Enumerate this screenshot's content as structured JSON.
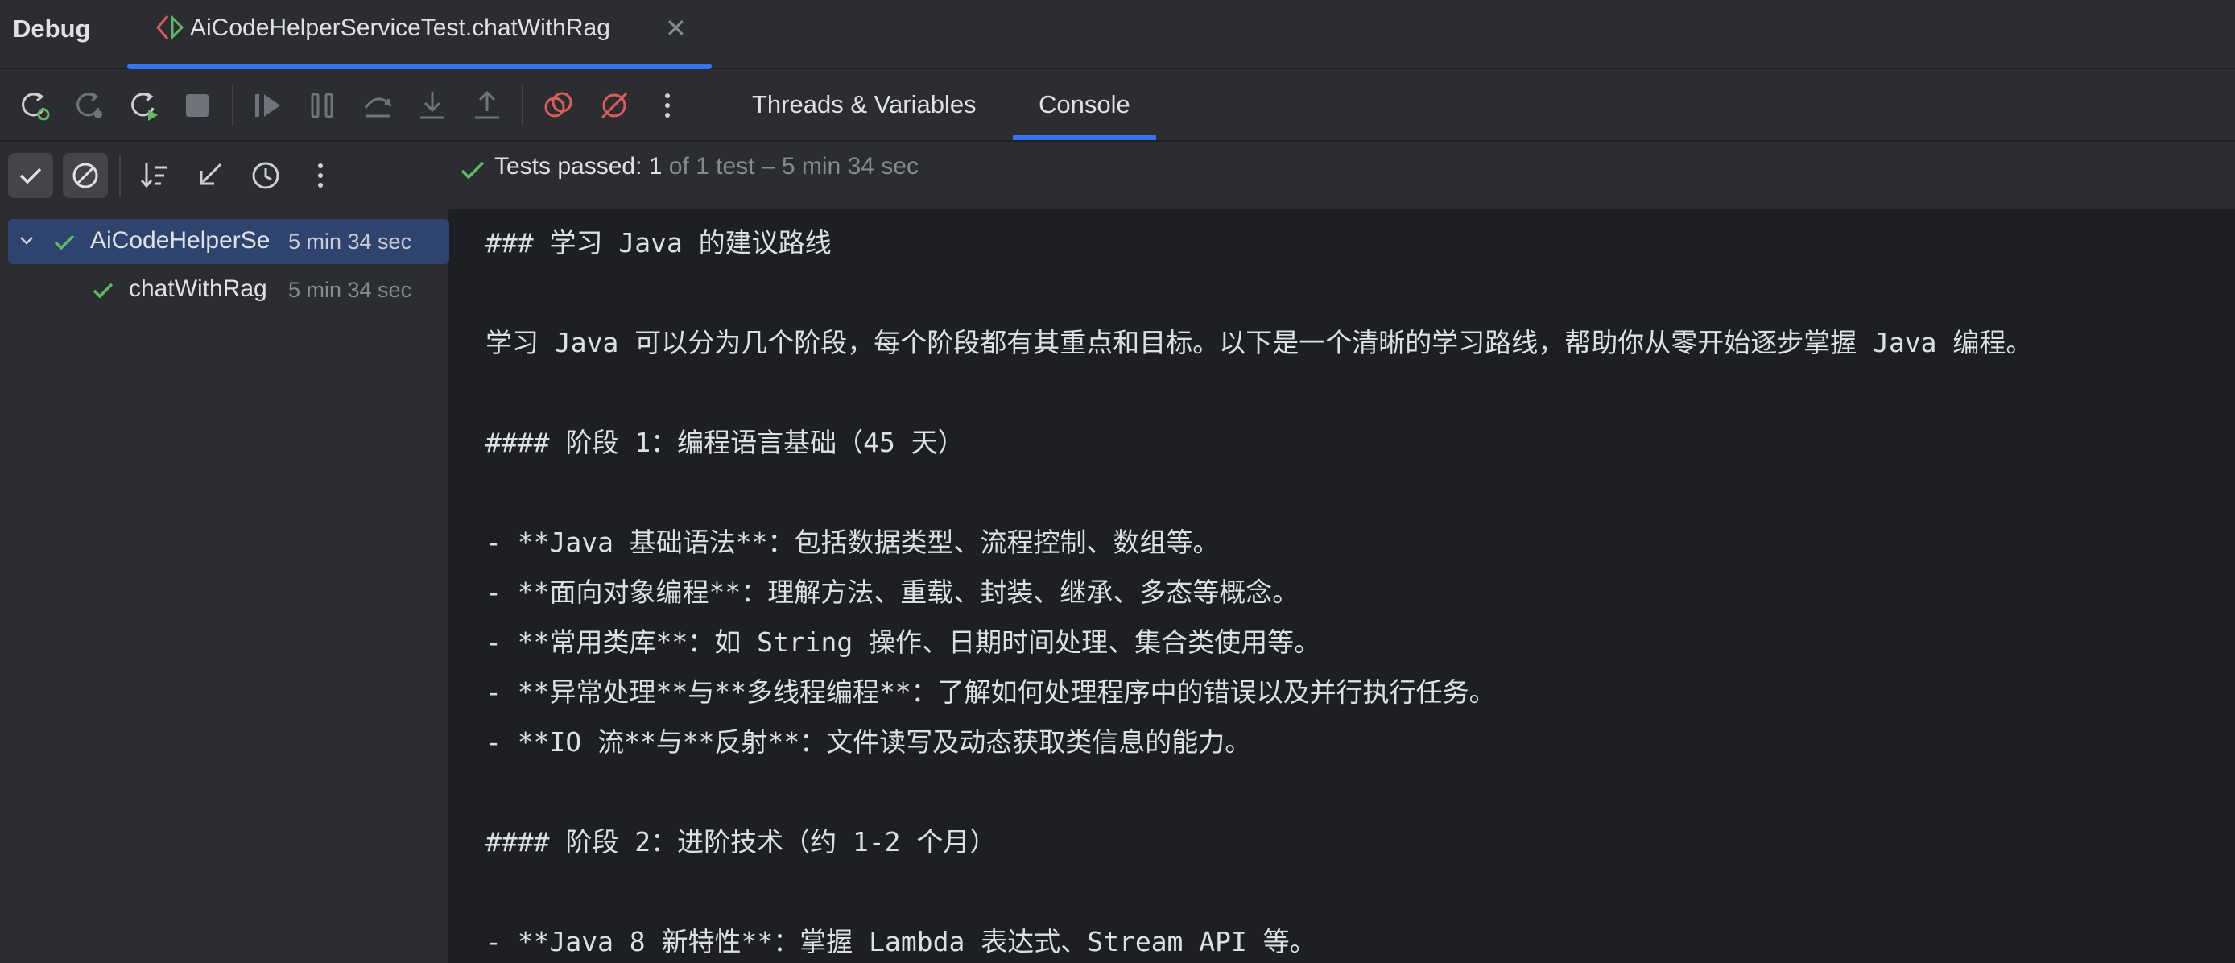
{
  "titlebar": {
    "panel_title": "Debug",
    "session_tab": {
      "title": "AiCodeHelperServiceTest.chatWithRag",
      "icon": "test-run-icon",
      "close_icon": "close-icon"
    }
  },
  "toolbar": {
    "buttons": [
      "rerun-icon",
      "rerun-failed-icon",
      "restart-icon",
      "stop-icon",
      "resume-icon",
      "pause-icon",
      "step-over-icon",
      "step-into-icon",
      "step-out-icon",
      "view-breakpoints-icon",
      "mute-breakpoints-icon",
      "more-options-icon"
    ],
    "tabs": [
      {
        "label": "Threads & Variables",
        "active": false
      },
      {
        "label": "Console",
        "active": true
      }
    ]
  },
  "test_toolbar": {
    "buttons": [
      "show-passed-icon",
      "show-ignored-icon",
      "sort-icon",
      "collapse-icon",
      "history-icon",
      "more-options-icon"
    ]
  },
  "test_tree": {
    "root": {
      "name": "AiCodeHelperSe",
      "duration": "5 min 34 sec",
      "status": "passed"
    },
    "children": [
      {
        "name": "chatWithRag",
        "duration": "5 min 34 sec",
        "status": "passed"
      }
    ]
  },
  "status": {
    "label": "Tests passed: ",
    "count": "1",
    "rest": " of 1 test – 5 min 34 sec"
  },
  "colors": {
    "accent": "#3574f0",
    "passed": "#5fb865",
    "danger": "#db5c5c"
  },
  "console": {
    "lines": [
      "### 学习 Java 的建议路线",
      "",
      "学习 Java 可以分为几个阶段，每个阶段都有其重点和目标。以下是一个清晰的学习路线，帮助你从零开始逐步掌握 Java 编程。",
      "",
      "#### 阶段 1：编程语言基础（45 天）",
      "",
      "- **Java 基础语法**：包括数据类型、流程控制、数组等。",
      "- **面向对象编程**：理解方法、重载、封装、继承、多态等概念。",
      "- **常用类库**：如 String 操作、日期时间处理、集合类使用等。",
      "- **异常处理**与**多线程编程**：了解如何处理程序中的错误以及并行执行任务。",
      "- **IO 流**与**反射**：文件读写及动态获取类信息的能力。",
      "",
      "#### 阶段 2：进阶技术（约 1-2 个月）",
      "",
      "- **Java 8 新特性**：掌握 Lambda 表达式、Stream API 等。"
    ]
  }
}
